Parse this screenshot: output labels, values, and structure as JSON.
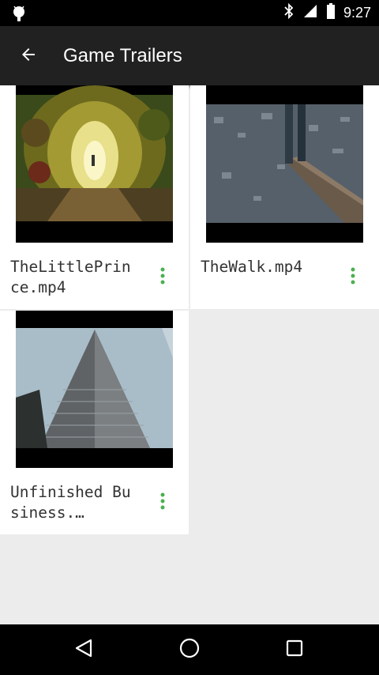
{
  "status_bar": {
    "time": "9:27",
    "icons": [
      "android-debug-icon",
      "bluetooth-icon",
      "signal-icon",
      "battery-icon"
    ]
  },
  "app_bar": {
    "title": "Game Trailers",
    "back_icon": "arrow-left-icon"
  },
  "videos": [
    {
      "name": "TheLittlePrince.mp4",
      "thumbnail": "forest-archway-thumbnail"
    },
    {
      "name": "TheWalk.mp4",
      "thumbnail": "city-from-height-thumbnail"
    },
    {
      "name": "Unfinished Business.…",
      "thumbnail": "skyscraper-thumbnail"
    }
  ],
  "nav_bar": {
    "buttons": [
      "back-triangle-icon",
      "home-circle-icon",
      "recents-square-icon"
    ]
  },
  "colors": {
    "app_bar": "#212121",
    "menu_dots": "#4caf50",
    "background": "#ececec"
  }
}
